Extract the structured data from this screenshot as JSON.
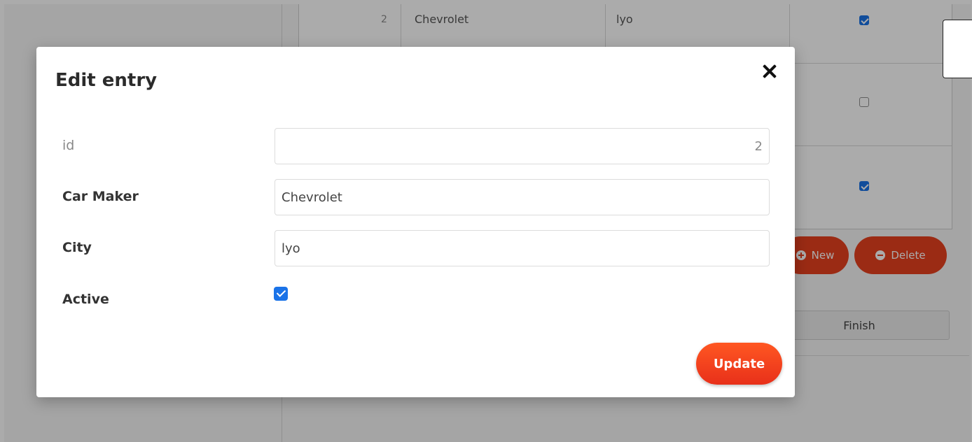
{
  "background_table": {
    "rows": [
      {
        "id": "2",
        "car_maker": "Chevrolet",
        "city": "lyo",
        "active": true
      },
      {
        "active": false
      },
      {
        "active": true
      }
    ]
  },
  "background_actions": {
    "new_label": "New",
    "delete_label": "Delete",
    "finish_label": "Finish"
  },
  "modal": {
    "title": "Edit entry",
    "fields": {
      "id": {
        "label": "id",
        "value": "2"
      },
      "car_maker": {
        "label": "Car Maker",
        "value": "Chevrolet"
      },
      "city": {
        "label": "City",
        "value": "lyo"
      },
      "active": {
        "label": "Active",
        "checked": true
      }
    },
    "update_label": "Update"
  },
  "colors": {
    "accent": "#e8401f",
    "checkbox": "#1a73e8"
  },
  "icons": {
    "close": "close-icon",
    "new": "plus-circle-icon",
    "delete": "minus-circle-icon"
  }
}
